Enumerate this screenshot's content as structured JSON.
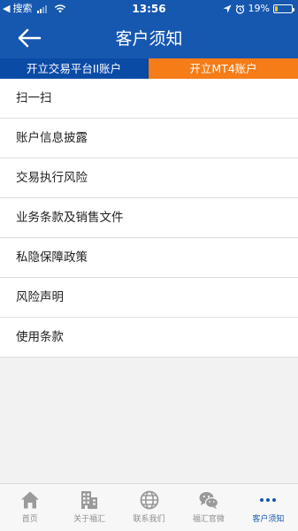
{
  "status_bar": {
    "back_chevron": "◀",
    "carrier": "搜索",
    "time": "13:56",
    "battery_percent": "19%",
    "battery_level": 0.19,
    "battery_color": "#f5c518"
  },
  "nav": {
    "title": "客户须知",
    "back_icon": "arrow-left-icon"
  },
  "colors": {
    "header_blue": "#1657b0",
    "tab_blue": "#0a4ba6",
    "tab_orange": "#f57c17"
  },
  "account_tabs": [
    {
      "label": "开立交易平台II账户"
    },
    {
      "label": "开立MT4账户"
    }
  ],
  "menu": {
    "items": [
      {
        "label": "扫一扫"
      },
      {
        "label": "账户信息披露"
      },
      {
        "label": "交易执行风险"
      },
      {
        "label": "业务条款及销售文件"
      },
      {
        "label": "私隐保障政策"
      },
      {
        "label": "风险声明"
      },
      {
        "label": "使用条款"
      }
    ]
  },
  "tab_bar": {
    "items": [
      {
        "label": "首页",
        "icon": "home-icon"
      },
      {
        "label": "关于福汇",
        "icon": "building-icon"
      },
      {
        "label": "联系我们",
        "icon": "globe-icon"
      },
      {
        "label": "福汇官微",
        "icon": "wechat-icon"
      },
      {
        "label": "客户须知",
        "icon": "more-dots-icon",
        "active": true
      }
    ]
  }
}
